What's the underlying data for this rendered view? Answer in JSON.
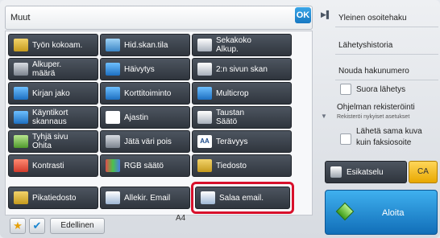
{
  "header": {
    "title": "Muut",
    "ok_label": "OK"
  },
  "grid": {
    "buttons": [
      {
        "label": "Työn kokoam.",
        "icon": "document-stack-icon"
      },
      {
        "label": "Hid.skan.tila",
        "icon": "slow-scan-icon"
      },
      {
        "label": "Sekakoko\nAlkup.",
        "icon": "mixed-size-icon"
      },
      {
        "label": "Alkuper.\nmäärä",
        "icon": "original-count-icon"
      },
      {
        "label": "Häivytys",
        "icon": "erase-icon"
      },
      {
        "label": "2:n sivun skan",
        "icon": "two-page-scan-icon"
      },
      {
        "label": "Kirjan jako",
        "icon": "book-divide-icon"
      },
      {
        "label": "Korttitoiminto",
        "icon": "card-icon"
      },
      {
        "label": "Multicrop",
        "icon": "multicrop-icon"
      },
      {
        "label": "Käyntikort\nskannaus",
        "icon": "business-card-icon"
      },
      {
        "label": "Ajastin",
        "icon": "clock-icon"
      },
      {
        "label": "Taustan\nSäätö",
        "icon": "background-adjust-icon"
      },
      {
        "label": "Tyhjä sivu\nOhita",
        "icon": "blank-page-icon"
      },
      {
        "label": "Jätä väri pois",
        "icon": "color-omit-icon"
      },
      {
        "label": "Terävyys",
        "icon": "sharpness-icon"
      },
      {
        "label": "Kontrasti",
        "icon": "contrast-icon"
      },
      {
        "label": "RGB säätö",
        "icon": "rgb-adjust-icon"
      },
      {
        "label": "Tiedosto",
        "icon": "file-icon"
      },
      {
        "label": "Pikatiedosto",
        "icon": "quick-file-icon"
      },
      {
        "label": "Allekir. Email",
        "icon": "signed-email-icon"
      },
      {
        "label": "Salaa email.",
        "icon": "encrypt-email-icon"
      }
    ]
  },
  "bottom": {
    "prev_label": "Edellinen",
    "paper_size_1": "A4",
    "paper_size_2": "A4"
  },
  "side": {
    "items": [
      "Yleinen osoitehaku",
      "Lähetyshistoria",
      "Nouda hakunumero"
    ],
    "direct_send": "Suora lähetys",
    "program_register": "Ohjelman rekisteröinti",
    "program_register_sub": "Rekisteröi nykyiset asetukset",
    "same_image_fax_1": "Lähetä sama kuva",
    "same_image_fax_2": "kuin faksiosoite",
    "preview_label": "Esikatselu",
    "ca_label": "CA",
    "start_label": "Aloita"
  },
  "colors": {
    "highlight": "#d8102b",
    "start": "#1a8ad6",
    "ca": "#f5c222"
  }
}
